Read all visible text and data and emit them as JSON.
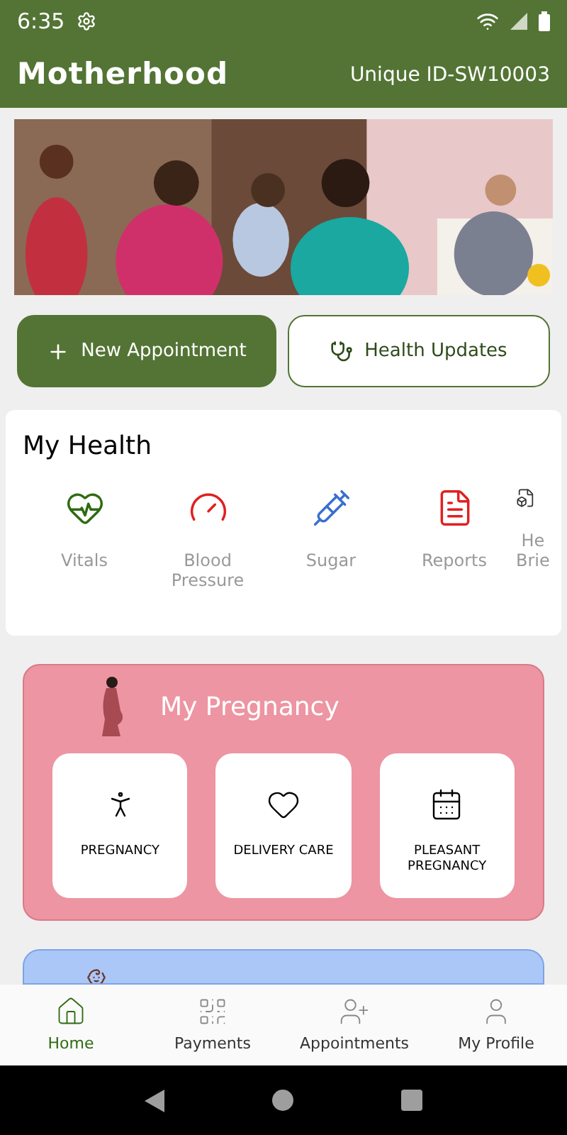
{
  "status_bar": {
    "time": "6:35"
  },
  "app_bar": {
    "title": "Motherhood",
    "unique_id": "Unique ID-SW10003"
  },
  "actions": [
    {
      "label": "New Appointment",
      "kind": "primary"
    },
    {
      "label": "Health Updates",
      "kind": "outline"
    }
  ],
  "my_health": {
    "title": "My Health",
    "items": [
      {
        "label": "Vitals"
      },
      {
        "label": "Blood\nPressure"
      },
      {
        "label": "Sugar"
      },
      {
        "label": "Reports"
      },
      {
        "label": "He\nBrie"
      }
    ]
  },
  "pregnancy": {
    "title": "My Pregnancy",
    "tiles": [
      {
        "label": "PREGNANCY"
      },
      {
        "label": "DELIVERY CARE"
      },
      {
        "label": "PLEASANT\nPREGNANCY"
      }
    ]
  },
  "bottom_nav": [
    {
      "label": "Home",
      "selected": true
    },
    {
      "label": "Payments",
      "selected": false
    },
    {
      "label": "Appointments",
      "selected": false
    },
    {
      "label": "My Profile",
      "selected": false
    }
  ]
}
